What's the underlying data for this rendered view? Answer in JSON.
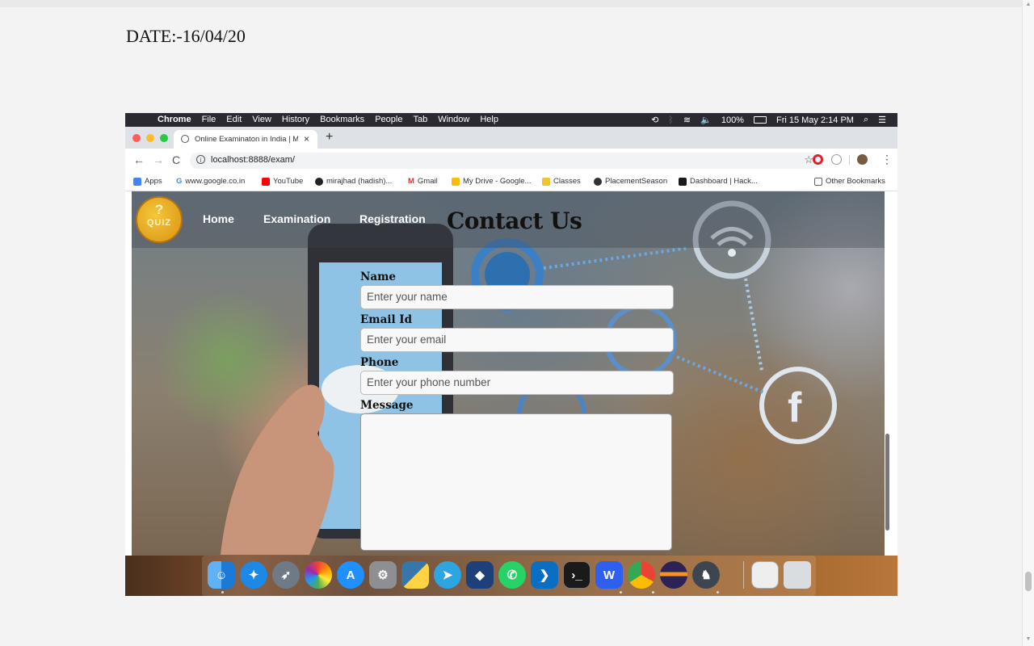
{
  "document": {
    "date_label": "DATE:-16/04/20"
  },
  "menubar": {
    "app": "Chrome",
    "menus": [
      "File",
      "Edit",
      "View",
      "History",
      "Bookmarks",
      "People",
      "Tab",
      "Window",
      "Help"
    ],
    "battery": "100%",
    "datetime": "Fri 15 May  2:14 PM"
  },
  "browser": {
    "tab_title": "Online Examinaton in India | M",
    "url": "localhost:8888/exam/",
    "new_tab": "+",
    "bookmarks": [
      "Apps",
      "www.google.co.in",
      "YouTube",
      "mirajhad (hadish)...",
      "Gmail",
      "My Drive - Google...",
      "Classes",
      "PlacementSeason",
      "Dashboard | Hack...",
      "Other Bookmarks"
    ]
  },
  "site": {
    "logo_text": "QUIZ",
    "logo_mark": "?",
    "nav": [
      "Home",
      "Examination",
      "Registration"
    ],
    "contact_title": "Contact Us"
  },
  "form": {
    "name_label": "Name",
    "name_placeholder": "Enter your name",
    "email_label": "Email Id",
    "email_placeholder": "Enter your email",
    "phone_label": "Phone",
    "phone_placeholder": "Enter your phone number",
    "message_label": "Message",
    "message_value": ""
  },
  "dock": {
    "apps": [
      "finder",
      "safari",
      "launchpad",
      "photos",
      "app-store",
      "system-preferences",
      "python",
      "telegram",
      "virtualbox",
      "whatsapp",
      "vscode",
      "terminal",
      "wps-office",
      "chrome",
      "eclipse",
      "mamp",
      "preview",
      "trash"
    ]
  },
  "colors": {
    "menubar": "#2b2a33",
    "tabstrip": "#dee1e6",
    "logo": "#f6c63a"
  }
}
